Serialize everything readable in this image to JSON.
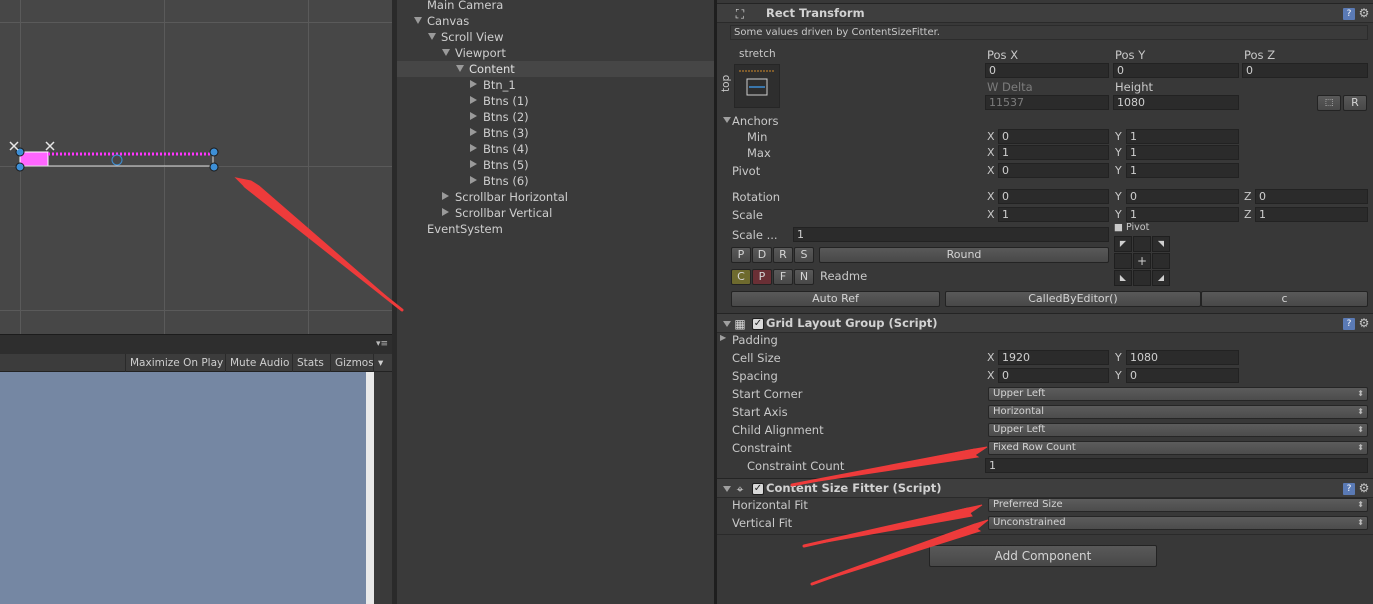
{
  "game_toolbar": {
    "maximize_on_play": "Maximize On Play",
    "mute_audio": "Mute Audio",
    "stats": "Stats",
    "gizmos": "Gizmos"
  },
  "hierarchy": {
    "items": [
      {
        "label": "Main Camera",
        "depth": 1,
        "arrow": "none"
      },
      {
        "label": "Canvas",
        "depth": 1,
        "arrow": "down"
      },
      {
        "label": "Scroll View",
        "depth": 2,
        "arrow": "down"
      },
      {
        "label": "Viewport",
        "depth": 3,
        "arrow": "down"
      },
      {
        "label": "Content",
        "depth": 4,
        "arrow": "down",
        "selected": true
      },
      {
        "label": "Btn_1",
        "depth": 5,
        "arrow": "right"
      },
      {
        "label": "Btns (1)",
        "depth": 5,
        "arrow": "right"
      },
      {
        "label": "Btns (2)",
        "depth": 5,
        "arrow": "right"
      },
      {
        "label": "Btns (3)",
        "depth": 5,
        "arrow": "right"
      },
      {
        "label": "Btns (4)",
        "depth": 5,
        "arrow": "right"
      },
      {
        "label": "Btns (5)",
        "depth": 5,
        "arrow": "right"
      },
      {
        "label": "Btns (6)",
        "depth": 5,
        "arrow": "right"
      },
      {
        "label": "Scrollbar Horizontal",
        "depth": 3,
        "arrow": "right"
      },
      {
        "label": "Scrollbar Vertical",
        "depth": 3,
        "arrow": "right"
      },
      {
        "label": "EventSystem",
        "depth": 1,
        "arrow": "none"
      }
    ]
  },
  "rect_transform": {
    "title": "Rect Transform",
    "info": "Some values driven by ContentSizeFitter.",
    "anchor_preset_h": "stretch",
    "anchor_preset_v": "top",
    "pos_x_label": "Pos X",
    "pos_y_label": "Pos Y",
    "pos_z_label": "Pos Z",
    "pos_x": "0",
    "pos_y": "0",
    "pos_z": "0",
    "w_delta_label": "W Delta",
    "height_label": "Height",
    "w_delta": "11537",
    "height": "1080",
    "r_button": "R",
    "anchors_label": "Anchors",
    "min_label": "Min",
    "max_label": "Max",
    "anchor_min_x": "0",
    "anchor_min_y": "1",
    "anchor_max_x": "1",
    "anchor_max_y": "1",
    "pivot_label": "Pivot",
    "pivot_x": "0",
    "pivot_y": "1",
    "rotation_label": "Rotation",
    "rot_x": "0",
    "rot_y": "0",
    "rot_z": "0",
    "scale_label": "Scale",
    "scale_x": "1",
    "scale_y": "1",
    "scale_z": "1",
    "x": "X",
    "y": "Y",
    "z": "Z"
  },
  "extra_tools": {
    "scale_dots_label": "Scale ...",
    "scale_dots_value": "1",
    "pivot_label": "Pivot",
    "buttons_pdrs": [
      "P",
      "D",
      "R",
      "S"
    ],
    "round_button": "Round",
    "buttons_cpfn": [
      "C",
      "P",
      "F",
      "N"
    ],
    "readme": "Readme",
    "auto_ref": "Auto Ref",
    "called_by_editor": "CalledByEditor()",
    "c_button": "c",
    "pivot_center": "+"
  },
  "grid_layout": {
    "title": "Grid Layout Group (Script)",
    "padding_label": "Padding",
    "cell_size_label": "Cell Size",
    "cell_x": "1920",
    "cell_y": "1080",
    "spacing_label": "Spacing",
    "spacing_x": "0",
    "spacing_y": "0",
    "start_corner_label": "Start Corner",
    "start_corner": "Upper Left",
    "start_axis_label": "Start Axis",
    "start_axis": "Horizontal",
    "child_alignment_label": "Child Alignment",
    "child_alignment": "Upper Left",
    "constraint_label": "Constraint",
    "constraint": "Fixed Row Count",
    "constraint_count_label": "Constraint Count",
    "constraint_count": "1"
  },
  "content_size_fitter": {
    "title": "Content Size Fitter (Script)",
    "horizontal_fit_label": "Horizontal Fit",
    "horizontal_fit": "Preferred Size",
    "vertical_fit_label": "Vertical Fit",
    "vertical_fit": "Unconstrained"
  },
  "add_component": "Add Component",
  "colors": {
    "annotation_arrow": "#ee3b3b",
    "selection_magenta": "#ff44ff",
    "gizmo_blue": "#3d8fd6",
    "game_view_bg": "#7587a3"
  }
}
